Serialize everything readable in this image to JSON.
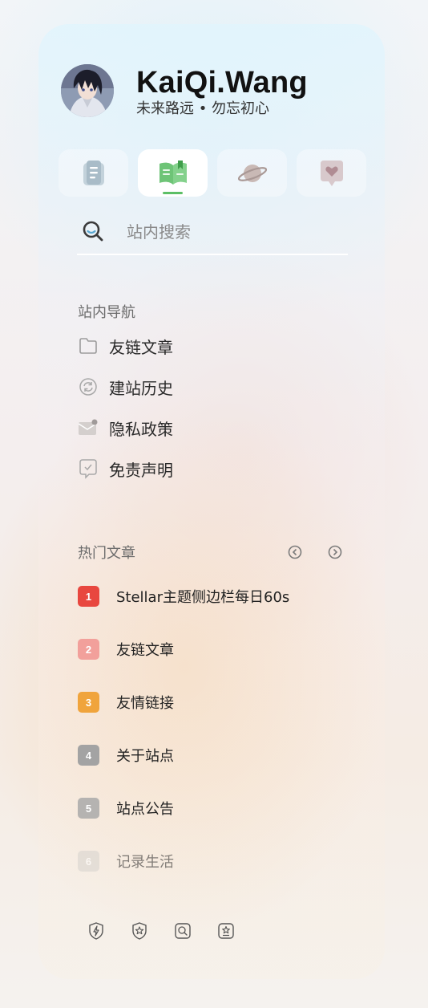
{
  "profile": {
    "name": "KaiQi.Wang",
    "motto": "未来路远 • 勿忘初心"
  },
  "tabs": [
    {
      "icon": "notes-icon"
    },
    {
      "icon": "wiki-book-icon",
      "active": true
    },
    {
      "icon": "planet-icon"
    },
    {
      "icon": "heart-chat-icon"
    }
  ],
  "search": {
    "placeholder": "站内搜索"
  },
  "site_nav": {
    "title": "站内导航",
    "items": [
      {
        "label": "友链文章",
        "icon": "folder-icon"
      },
      {
        "label": "建站历史",
        "icon": "sync-icon"
      },
      {
        "label": "隐私政策",
        "icon": "mail-icon"
      },
      {
        "label": "免责声明",
        "icon": "check-message-icon"
      }
    ]
  },
  "hot_posts": {
    "title": "热门文章",
    "items": [
      {
        "rank": "1",
        "label": "Stellar主题侧边栏每日60s",
        "color": "#e8473f"
      },
      {
        "rank": "2",
        "label": "友链文章",
        "color": "#f2a09b"
      },
      {
        "rank": "3",
        "label": "友情链接",
        "color": "#f0a43c"
      },
      {
        "rank": "4",
        "label": "关于站点",
        "color": "#a3a3a3"
      },
      {
        "rank": "5",
        "label": "站点公告",
        "color": "#b5b3b1"
      },
      {
        "rank": "6",
        "label": "记录生活",
        "color": "#d6d2ce"
      }
    ]
  },
  "footer_icons": [
    "shield-bolt-icon",
    "shield-star-icon",
    "search-box-icon",
    "star-box-icon"
  ],
  "colors": {
    "accent_green": "#5cbf66",
    "text_primary": "#111111"
  }
}
